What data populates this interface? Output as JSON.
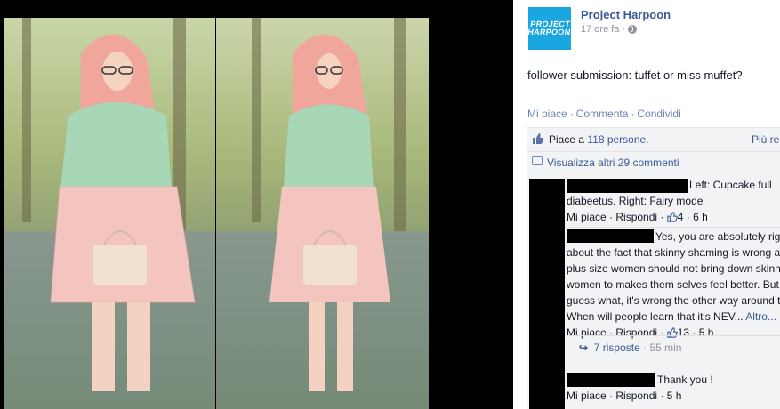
{
  "post": {
    "page_name": "Project Harpoon",
    "logo_text": "PROJECT HARPOON",
    "time": "17 ore fa",
    "dot": "·",
    "text": "follower submission: tuffet or miss muffet?",
    "actions": {
      "like": "Mi piace",
      "comment": "Commenta",
      "share": "Condividi"
    }
  },
  "likes": {
    "prefix": "Piace a ",
    "count_link": "118 persone.",
    "more": "Più re"
  },
  "view_more": "Visualizza altri 29 commenti",
  "comments": [
    {
      "line1": "Left: Cupcake full",
      "line2": "diabeetus. Right: Fairy mode",
      "like": "Mi piace",
      "reply": "Rispondi",
      "likes": "4",
      "time": "6 h"
    },
    {
      "line1": "Yes, you are absolutely rig",
      "line2": "about the fact that skinny shaming is wrong a",
      "line3": "plus size women should not bring down skinn",
      "line4": "women to makes them selves feel better. But",
      "line5": "guess what, it's wrong the other way around t",
      "line6": "When will people learn that it's NEV...",
      "more": "Altro...",
      "like": "Mi piace",
      "reply": "Rispondi",
      "likes": "13",
      "time": "5 h",
      "replies_label": "7 risposte",
      "replies_time": "55 min"
    },
    {
      "line1": "Thank you !",
      "like": "Mi piace",
      "reply": "Rispondi",
      "time": "5 h"
    }
  ],
  "colors": {
    "link": "#3b5998",
    "muted": "#90949c",
    "panel_bg": "#f2f3f5",
    "logo_bg": "#1aa6e0"
  }
}
